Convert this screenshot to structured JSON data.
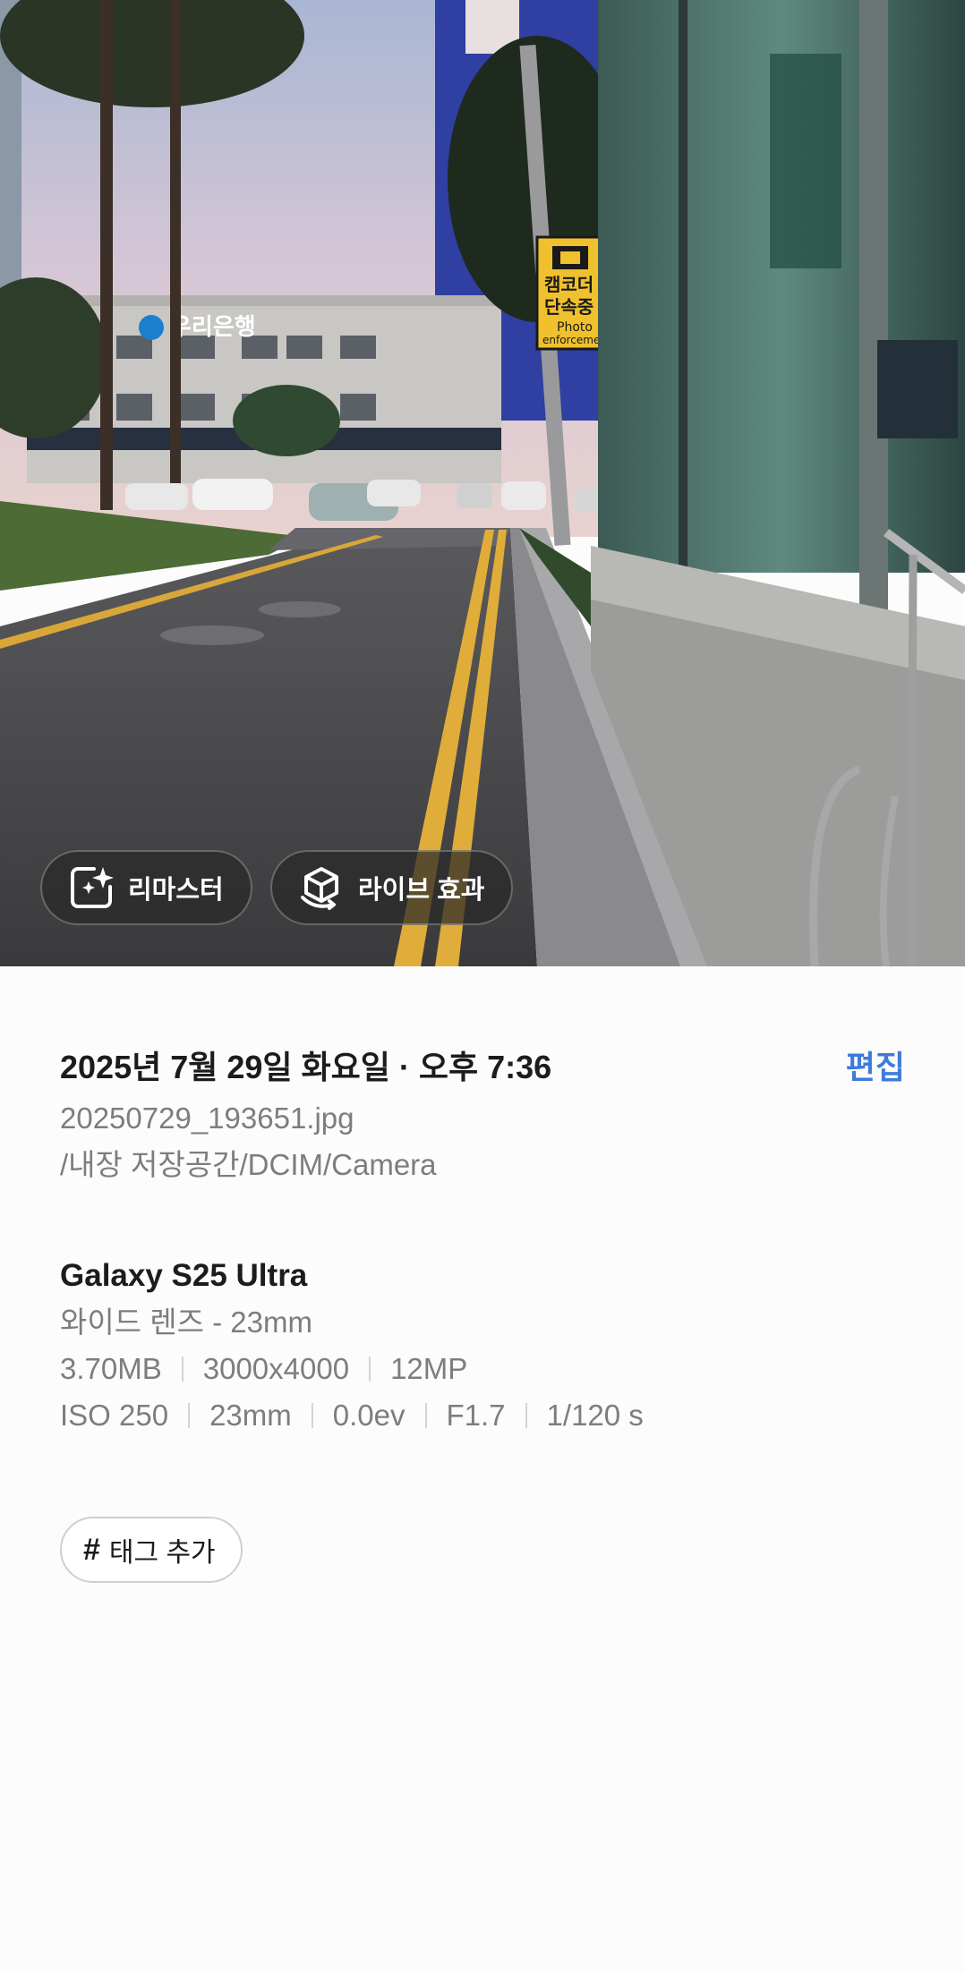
{
  "photo": {
    "sign_text_1": "캠코더",
    "sign_text_2": "단속중",
    "sign_text_3": "Photo",
    "sign_text_4": "enforcement",
    "bank_sign": "우리은행"
  },
  "actions": {
    "remaster_label": "리마스터",
    "live_effect_label": "라이브 효과"
  },
  "details": {
    "datetime": "2025년 7월 29일 화요일 · 오후 7:36",
    "edit_label": "편집",
    "filename": "20250729_193651.jpg",
    "path": "/내장 저장공간/DCIM/Camera",
    "device": "Galaxy S25 Ultra",
    "lens": "와이드 렌즈 - 23mm",
    "file_size": "3.70MB",
    "resolution": "3000x4000",
    "megapixels": "12MP",
    "iso": "ISO 250",
    "focal_length": "23mm",
    "exposure": "0.0ev",
    "aperture": "F1.7",
    "shutter": "1/120 s"
  },
  "tags": {
    "add_tag_label": "태그 추가"
  }
}
